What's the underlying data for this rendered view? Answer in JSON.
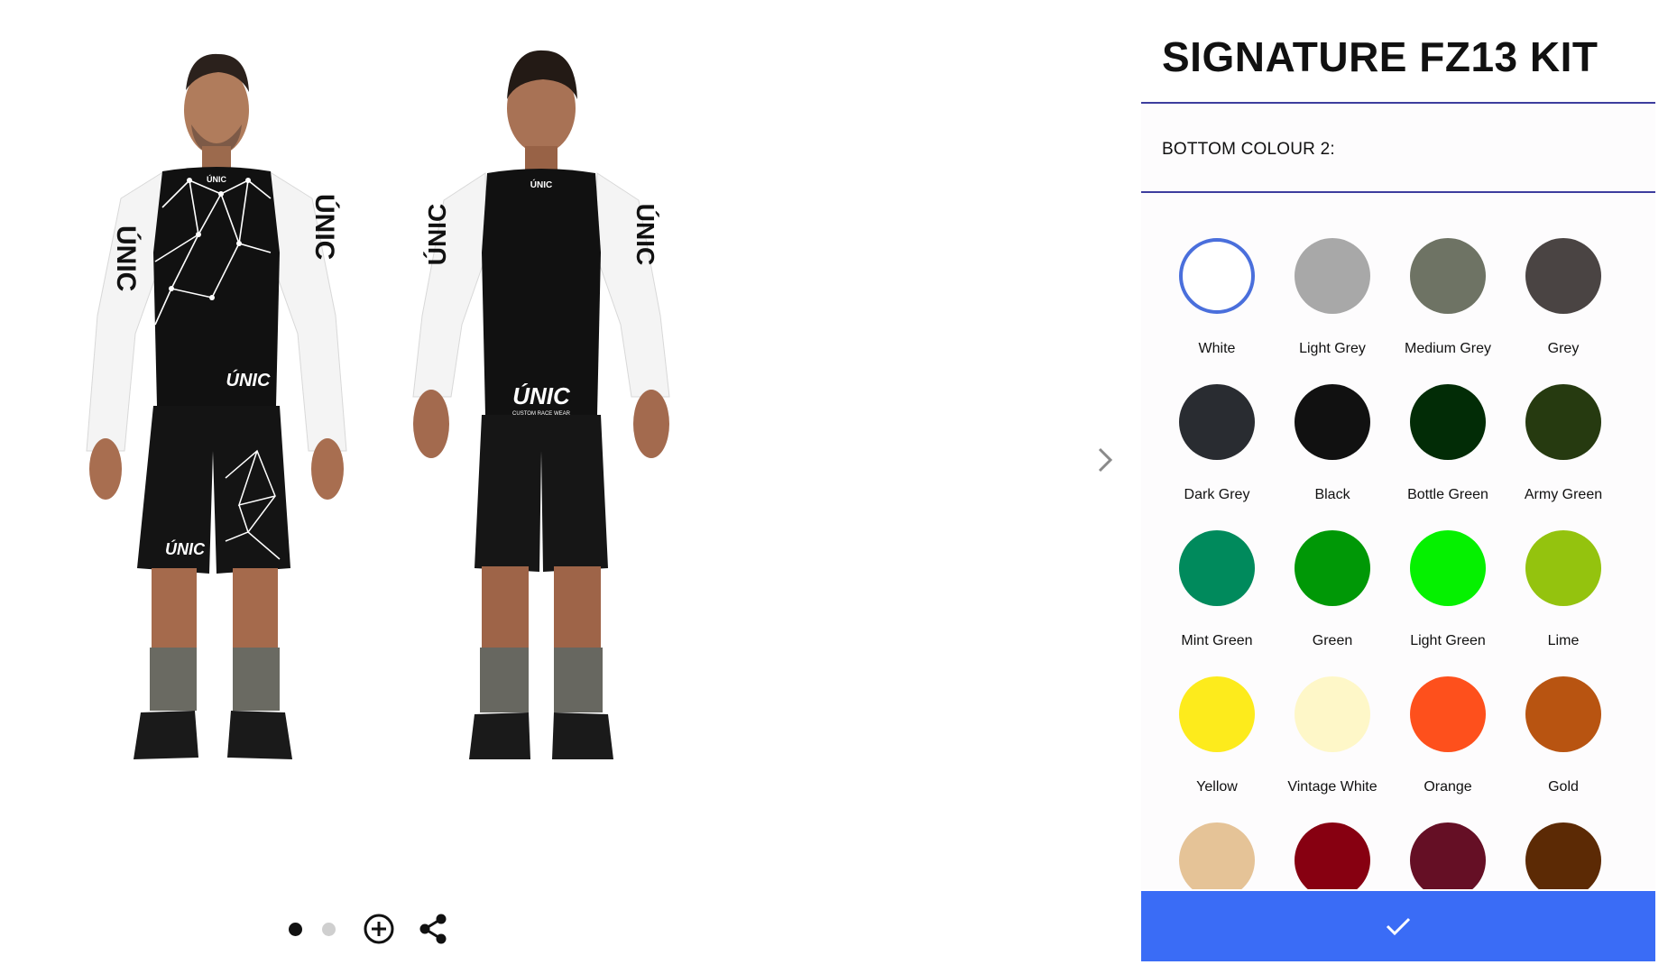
{
  "product": {
    "title": "SIGNATURE FZ13 KIT"
  },
  "option": {
    "label": "BOTTOM COLOUR 2:"
  },
  "brand": {
    "logo_text": "ÚNIC",
    "tagline": "CUSTOM RACE WEAR"
  },
  "viewer": {
    "views": [
      "front",
      "back"
    ],
    "active_view_index": 0,
    "controls": [
      "zoom-in-icon",
      "share-icon"
    ],
    "next_icon": "chevron-right-icon"
  },
  "swatches": [
    {
      "name": "White",
      "color": "#ffffff",
      "selected": true
    },
    {
      "name": "Light Grey",
      "color": "#a8a8a8",
      "selected": false
    },
    {
      "name": "Medium Grey",
      "color": "#6e7364",
      "selected": false
    },
    {
      "name": "Grey",
      "color": "#4a4443",
      "selected": false
    },
    {
      "name": "Dark Grey",
      "color": "#292c31",
      "selected": false
    },
    {
      "name": "Black",
      "color": "#111111",
      "selected": false
    },
    {
      "name": "Bottle Green",
      "color": "#022c06",
      "selected": false
    },
    {
      "name": "Army Green",
      "color": "#263a10",
      "selected": false
    },
    {
      "name": "Mint Green",
      "color": "#008a5c",
      "selected": false
    },
    {
      "name": "Green",
      "color": "#009806",
      "selected": false
    },
    {
      "name": "Light Green",
      "color": "#05f100",
      "selected": false
    },
    {
      "name": "Lime",
      "color": "#94c30e",
      "selected": false
    },
    {
      "name": "Yellow",
      "color": "#fdeb1c",
      "selected": false
    },
    {
      "name": "Vintage White",
      "color": "#fef7c8",
      "selected": false
    },
    {
      "name": "Orange",
      "color": "#fe501c",
      "selected": false
    },
    {
      "name": "Gold",
      "color": "#b85411",
      "selected": false
    },
    {
      "name": "",
      "color": "#e5c397",
      "selected": false
    },
    {
      "name": "",
      "color": "#870011",
      "selected": false
    },
    {
      "name": "",
      "color": "#650f25",
      "selected": false
    },
    {
      "name": "",
      "color": "#5c2a05",
      "selected": false
    }
  ],
  "confirm": {
    "icon": "checkmark-icon",
    "color": "#3a6cf6"
  }
}
